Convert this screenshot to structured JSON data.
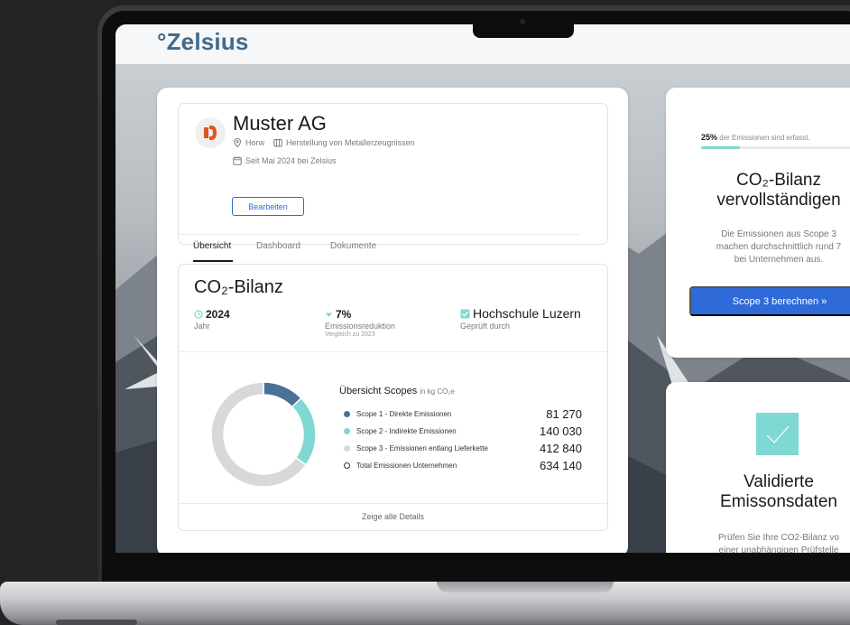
{
  "app": {
    "logo": "°Zelsius"
  },
  "company": {
    "name": "Muster AG",
    "location": "Horw",
    "industry": "Herstellung von Metallerzeugnissen",
    "since": "Seit Mai 2024 bei Zelsius",
    "edit_label": "Bearbeiten",
    "tabs": [
      {
        "label": "Übersicht",
        "active": true
      },
      {
        "label": "Dashboard",
        "active": false
      },
      {
        "label": "Dokumente",
        "active": false
      }
    ]
  },
  "co2": {
    "title": "CO₂-Bilanz",
    "stats": {
      "year_value": "2024",
      "year_label": "Jahr",
      "reduction_value": "7%",
      "reduction_label": "Emissionsreduktion",
      "reduction_sub": "Vergleich zu 2023",
      "auditor_value": "Hochschule Luzern",
      "auditor_label": "Geprüft durch"
    },
    "scopes_title": "Übersicht Scopes",
    "scopes_unit": "in kg CO₂e",
    "scopes": [
      {
        "label": "Scope 1 - Direkte Emissionen",
        "value": "81 270",
        "color": "#4a7298"
      },
      {
        "label": "Scope 2 - Indirekte Emissionen",
        "value": "140 030",
        "color": "#7fd8d1"
      },
      {
        "label": "Scope 3 - Emissionen entlang Lieferkette",
        "value": "412 840",
        "color": "#d7d8da"
      },
      {
        "label": "Total Emissionen Unternehmen",
        "value": "634 140",
        "color": "ring"
      }
    ],
    "details_link": "Zeige alle Details"
  },
  "chart_data": {
    "type": "pie",
    "categories": [
      "Scope 1",
      "Scope 2",
      "Scope 3"
    ],
    "values": [
      81270,
      140030,
      412840
    ],
    "colors": [
      "#4a7298",
      "#7fd8d1",
      "#d7d8da"
    ],
    "donut": true
  },
  "cards": {
    "progress": {
      "percent": 25,
      "percent_label": "25%",
      "text": "der Emissionen sind erfasst.",
      "title_line1": "CO₂-Bilanz",
      "title_line2": "vervollständigen",
      "text_line1": "Die Emissionen aus Scope 3",
      "text_line2": "machen durchschnittlich rund 7",
      "text_line3": "bei Unternehmen aus.",
      "cta_label": "Scope 3 berechnen  »"
    },
    "validated": {
      "title_line1": "Validierte",
      "title_line2": "Emissonsdaten",
      "text_line1": "Prüfen Sie Ihre CO2-Bilanz vo",
      "text_line2": "einer unabhängigen Prüfstelle"
    }
  },
  "colors": {
    "brand": "#426a89",
    "accent": "#2f6ad9",
    "teal": "#7fd8d1",
    "scope1": "#4a7298"
  },
  "icons": {
    "location": "location-pin-icon",
    "industry": "factory-icon",
    "calendar": "calendar-icon",
    "year": "clock-icon",
    "reduction": "triangle-down-icon",
    "verified": "checkbox-icon",
    "check": "checkmark-icon",
    "company": "company-logo-icon"
  }
}
